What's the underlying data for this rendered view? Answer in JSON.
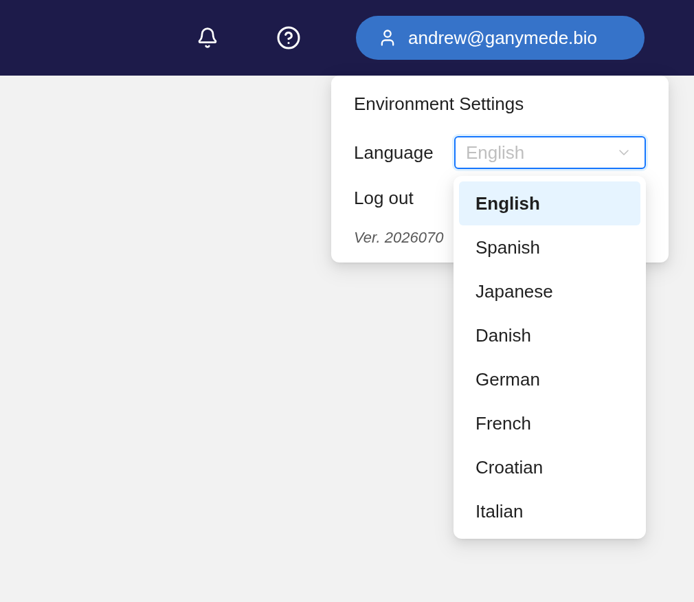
{
  "top_bar": {
    "user_button": {
      "label": "andrew@ganymede.bio"
    }
  },
  "settings_menu": {
    "title": "Environment Settings",
    "language": {
      "label": "Language",
      "placeholder": "English",
      "expanded": true
    },
    "logout": "Log out",
    "version": "Ver. 2026070"
  },
  "language_options": [
    {
      "label": "English",
      "selected": true
    },
    {
      "label": "Spanish",
      "selected": false
    },
    {
      "label": "Japanese",
      "selected": false
    },
    {
      "label": "Danish",
      "selected": false
    },
    {
      "label": "German",
      "selected": false
    },
    {
      "label": "French",
      "selected": false
    },
    {
      "label": "Croatian",
      "selected": false
    },
    {
      "label": "Italian",
      "selected": false
    }
  ]
}
